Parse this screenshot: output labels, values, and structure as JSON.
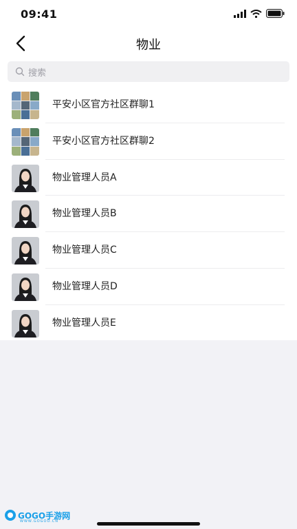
{
  "status_bar": {
    "time": "09:41"
  },
  "nav": {
    "title": "物业"
  },
  "search": {
    "placeholder": "搜索"
  },
  "contacts": [
    {
      "name": "平安小区官方社区群聊1",
      "type": "group"
    },
    {
      "name": "平安小区官方社区群聊2",
      "type": "group"
    },
    {
      "name": "物业管理人员A",
      "type": "person"
    },
    {
      "name": "物业管理人员B",
      "type": "person"
    },
    {
      "name": "物业管理人员C",
      "type": "person"
    },
    {
      "name": "物业管理人员D",
      "type": "person"
    },
    {
      "name": "物业管理人员E",
      "type": "person"
    }
  ],
  "watermark": {
    "brand": "GOGO手游网",
    "domain": "WWW.GOGOO.CN"
  }
}
